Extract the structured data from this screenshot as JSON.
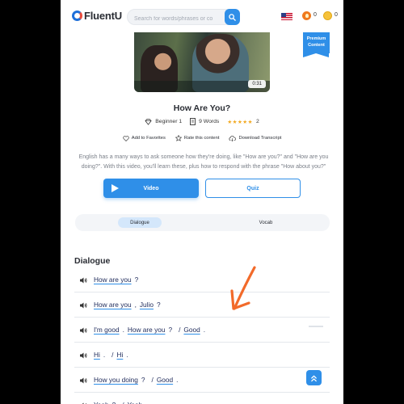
{
  "header": {
    "logo_text": "FluentU",
    "search_placeholder": "Search for words/phrases or co",
    "streak_count": "0",
    "coin_count": "0"
  },
  "video": {
    "duration": "0:31",
    "premium_badge": "Premium Content"
  },
  "content": {
    "title": "How Are You?",
    "level": "Beginner 1",
    "word_count": "9 Words",
    "rating_stars": "★★★★★",
    "rating_count": "2",
    "actions": {
      "favorites": "Add to Favorites",
      "rate": "Rate this content",
      "transcript": "Download Transcript"
    },
    "description": "English has a many ways to ask someone how they're doing, like \"How are you?\" and \"How are you doing?\". With this video, you'll learn these, plus how to respond with the phrase \"How about you?\""
  },
  "buttons": {
    "video": "Video",
    "quiz": "Quiz"
  },
  "tabs": {
    "dialogue": "Dialogue",
    "vocab": "Vocab"
  },
  "dialogue": {
    "section_title": "Dialogue",
    "lines": [
      {
        "tokens": [
          {
            "t": "How are you",
            "w": true
          },
          {
            "t": "?",
            "w": false
          }
        ]
      },
      {
        "tokens": [
          {
            "t": "How are you",
            "w": true
          },
          {
            "t": ",",
            "w": false
          },
          {
            "t": "Julio",
            "w": true
          },
          {
            "t": "?",
            "w": false
          }
        ]
      },
      {
        "tokens": [
          {
            "t": "I'm good",
            "w": true
          },
          {
            "t": ".",
            "w": false
          },
          {
            "t": "How are you",
            "w": true
          },
          {
            "t": "?",
            "w": false
          },
          {
            "t": "/",
            "w": false
          },
          {
            "t": "Good",
            "w": true
          },
          {
            "t": ".",
            "w": false
          }
        ]
      },
      {
        "tokens": [
          {
            "t": "Hi",
            "w": true
          },
          {
            "t": ".",
            "w": false
          },
          {
            "t": "/",
            "w": false
          },
          {
            "t": "Hi",
            "w": true
          },
          {
            "t": ".",
            "w": false
          }
        ]
      },
      {
        "tokens": [
          {
            "t": "How you doing",
            "w": true
          },
          {
            "t": "?",
            "w": false
          },
          {
            "t": "/",
            "w": false
          },
          {
            "t": "Good",
            "w": true
          },
          {
            "t": ".",
            "w": false
          }
        ]
      },
      {
        "tokens": [
          {
            "t": "Yeah",
            "w": true
          },
          {
            "t": "?",
            "w": false
          },
          {
            "t": "/",
            "w": false
          },
          {
            "t": "Yeah",
            "w": true
          }
        ]
      }
    ]
  },
  "colors": {
    "accent": "#2f8fe8",
    "annotation_arrow": "#f26a2a",
    "star": "#f2a81d"
  }
}
